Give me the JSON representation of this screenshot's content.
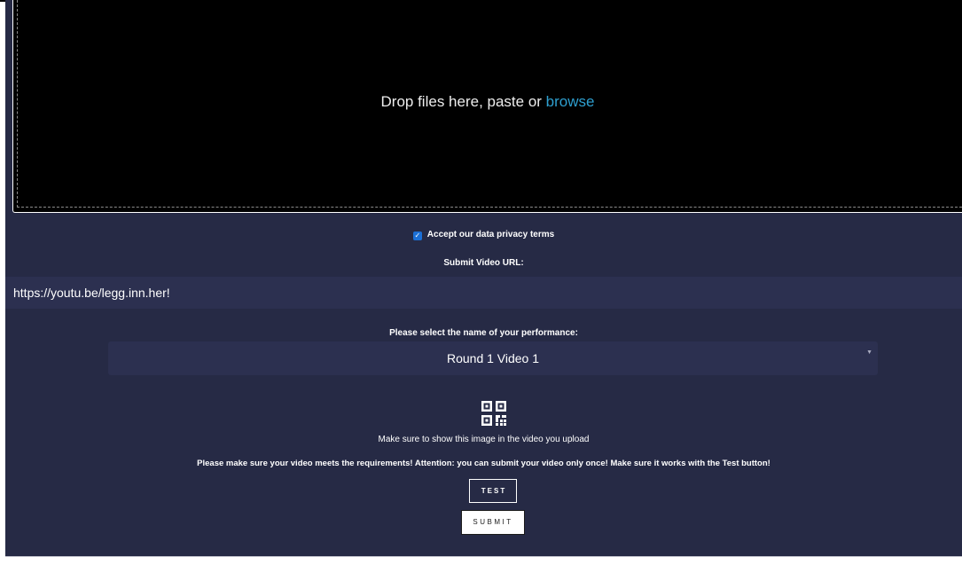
{
  "dropzone": {
    "text": "Drop files here, paste or",
    "browse_link": "browse"
  },
  "privacy": {
    "checked": true,
    "label": "Accept our data privacy terms"
  },
  "url": {
    "label": "Submit Video URL:",
    "value": "https://youtu.be/legg.inn.her!"
  },
  "performance": {
    "label": "Please select the name of your performance:",
    "selected": "Round 1 Video 1"
  },
  "qr": {
    "icon": "qr-code-icon",
    "caption": "Make sure to show this image in the video you upload"
  },
  "requirements_text": "Please make sure your video meets the requirements! Attention: you can submit your video only once! Make sure it works with the Test button!",
  "buttons": {
    "test": "TEST",
    "submit": "SUBMIT"
  },
  "colors": {
    "background": "#262a45",
    "input_bg": "#2c3050",
    "dropzone_bg": "#000000",
    "link": "#2e9fcf",
    "checkbox": "#1b6fd6"
  }
}
